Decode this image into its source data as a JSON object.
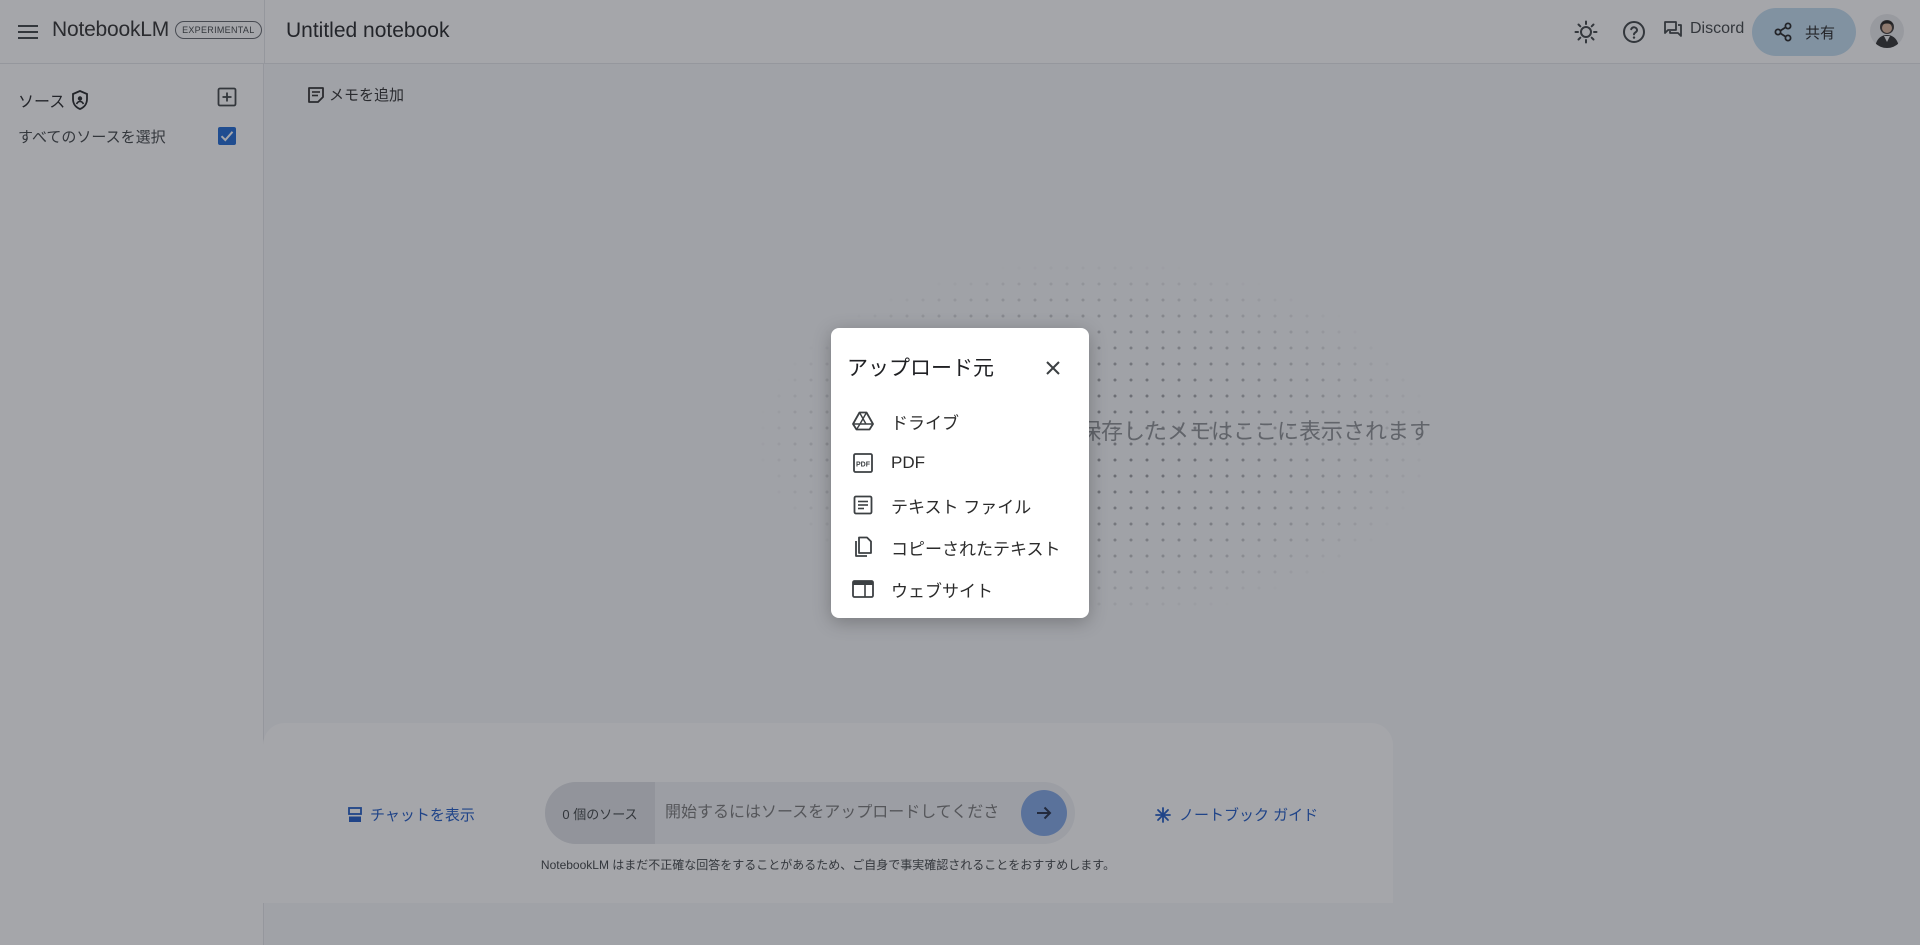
{
  "header": {
    "brand_name": "NotebookLM",
    "brand_badge": "EXPERIMENTAL",
    "notebook_title": "Untitled notebook",
    "discord_label": "Discord",
    "share_label": "共有"
  },
  "sidebar": {
    "title": "ソース",
    "select_all_label": "すべてのソースを選択",
    "select_all_checked": true
  },
  "main": {
    "add_note_label": "メモを追加",
    "empty_message": "保存したメモはここに表示されます"
  },
  "chat": {
    "show_chat_label": "チャットを表示",
    "source_count": "0 個のソース",
    "query_placeholder": "開始するにはソースをアップロードしてくださ",
    "notebook_guide_label": "ノートブック ガイド",
    "disclaimer": "NotebookLM はまだ不正確な回答をすることがあるため、ご自身で事実確認されることをおすすめします。"
  },
  "dialog": {
    "title": "アップロード元",
    "items": [
      {
        "label": "ドライブ",
        "icon": "drive-icon"
      },
      {
        "label": "PDF",
        "icon": "pdf-icon"
      },
      {
        "label": "テキスト ファイル",
        "icon": "text-file-icon"
      },
      {
        "label": "コピーされたテキスト",
        "icon": "copy-icon"
      },
      {
        "label": "ウェブサイト",
        "icon": "website-icon"
      }
    ]
  },
  "colors": {
    "accent": "#1a66d2",
    "link": "#1a56c4",
    "share_bg": "#c2dcf0",
    "send_bg": "#7fa6e6",
    "overlay": "rgba(40,44,52,0.42)"
  }
}
